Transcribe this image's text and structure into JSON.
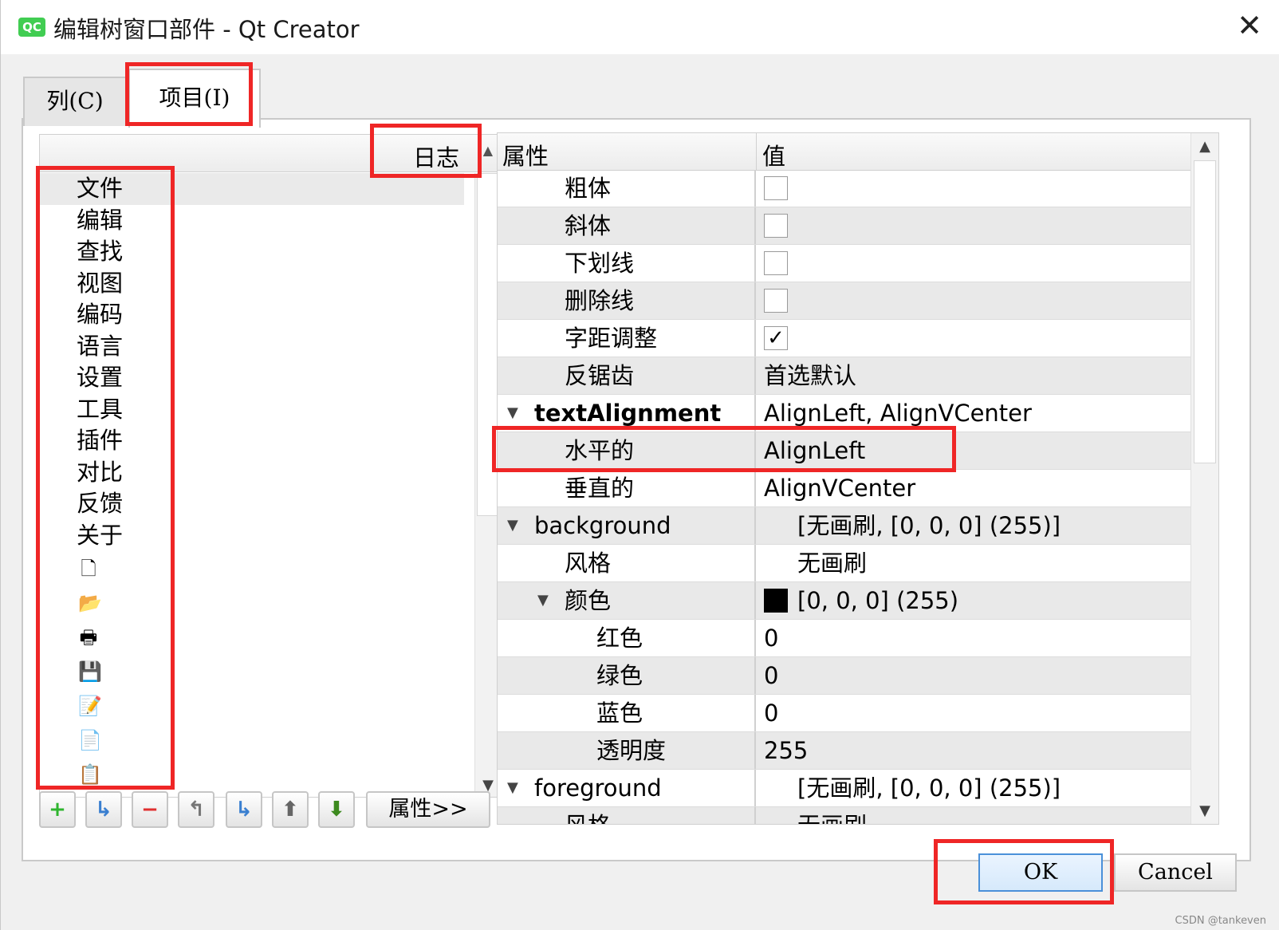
{
  "window": {
    "title": "编辑树窗口部件 - Qt Creator",
    "logo_text": "QC",
    "close_glyph": "✕"
  },
  "tabs": [
    {
      "label": "列(C)",
      "active": false
    },
    {
      "label": "项目(I)",
      "active": true
    }
  ],
  "tree": {
    "header": "日志",
    "items": [
      "文件",
      "编辑",
      "查找",
      "视图",
      "编码",
      "语言",
      "设置",
      "工具",
      "插件",
      "对比",
      "反馈",
      "关于"
    ],
    "icon_items": [
      {
        "icon": "new-file-icon",
        "glyph": "🗋"
      },
      {
        "icon": "open-folder-icon",
        "glyph": "📂"
      },
      {
        "icon": "printer-icon",
        "glyph": "🖶"
      },
      {
        "icon": "save-icon",
        "glyph": "💾"
      },
      {
        "icon": "save-as-icon",
        "glyph": "📝"
      },
      {
        "icon": "copy-icon",
        "glyph": "📄"
      },
      {
        "icon": "paste-icon",
        "glyph": "📋"
      }
    ]
  },
  "toolbar": {
    "buttons": [
      {
        "icon": "add-item-icon",
        "glyph": "+",
        "color": "#2fb52f"
      },
      {
        "icon": "add-subitem-icon",
        "glyph": "↳",
        "color": "#3a7fd0"
      },
      {
        "icon": "remove-item-icon",
        "glyph": "−",
        "color": "#e03030"
      },
      {
        "icon": "move-left-icon",
        "glyph": "↰",
        "color": "#777777"
      },
      {
        "icon": "move-right-icon",
        "glyph": "↳",
        "color": "#3a7fd0"
      },
      {
        "icon": "move-up-icon",
        "glyph": "⬆",
        "color": "#666666"
      },
      {
        "icon": "move-down-icon",
        "glyph": "⬇",
        "color": "#3d8a1f"
      }
    ],
    "properties_label": "属性>>"
  },
  "properties": {
    "header_name": "属性",
    "header_value": "值",
    "rows": [
      {
        "name": "粗体",
        "value": "",
        "check": "unchecked",
        "depth": 1
      },
      {
        "name": "斜体",
        "value": "",
        "check": "unchecked",
        "depth": 1
      },
      {
        "name": "下划线",
        "value": "",
        "check": "unchecked",
        "depth": 1
      },
      {
        "name": "删除线",
        "value": "",
        "check": "unchecked",
        "depth": 1
      },
      {
        "name": "字距调整",
        "value": "",
        "check": "checked",
        "depth": 1
      },
      {
        "name": "反锯齿",
        "value": "首选默认",
        "depth": 1
      },
      {
        "name": "textAlignment",
        "value": "AlignLeft, AlignVCenter",
        "depth": 0,
        "expanded": true,
        "bold": true
      },
      {
        "name": "水平的",
        "value": "AlignLeft",
        "depth": 1
      },
      {
        "name": "垂直的",
        "value": "AlignVCenter",
        "depth": 1
      },
      {
        "name": "background",
        "value": "[无画刷, [0, 0, 0] (255)]",
        "depth": 0,
        "expanded": true,
        "indent_value": true
      },
      {
        "name": "风格",
        "value": "无画刷",
        "depth": 1,
        "indent_value": true
      },
      {
        "name": "颜色",
        "value": "[0, 0, 0] (255)",
        "depth": 1,
        "expanded": true,
        "swatch": "#000000"
      },
      {
        "name": "红色",
        "value": "0",
        "depth": 2
      },
      {
        "name": "绿色",
        "value": "0",
        "depth": 2
      },
      {
        "name": "蓝色",
        "value": "0",
        "depth": 2
      },
      {
        "name": "透明度",
        "value": "255",
        "depth": 2
      },
      {
        "name": "foreground",
        "value": "[无画刷, [0, 0, 0] (255)]",
        "depth": 0,
        "expanded": true,
        "indent_value": true
      },
      {
        "name": "风格",
        "value": "无画刷",
        "depth": 1,
        "indent_value": true
      }
    ]
  },
  "buttons": {
    "ok": "OK",
    "cancel": "Cancel"
  },
  "watermark": "CSDN @tankeven",
  "colors": {
    "annotation": "#ef2626",
    "accent": "#4a90d9",
    "qt_green": "#41cd52"
  }
}
